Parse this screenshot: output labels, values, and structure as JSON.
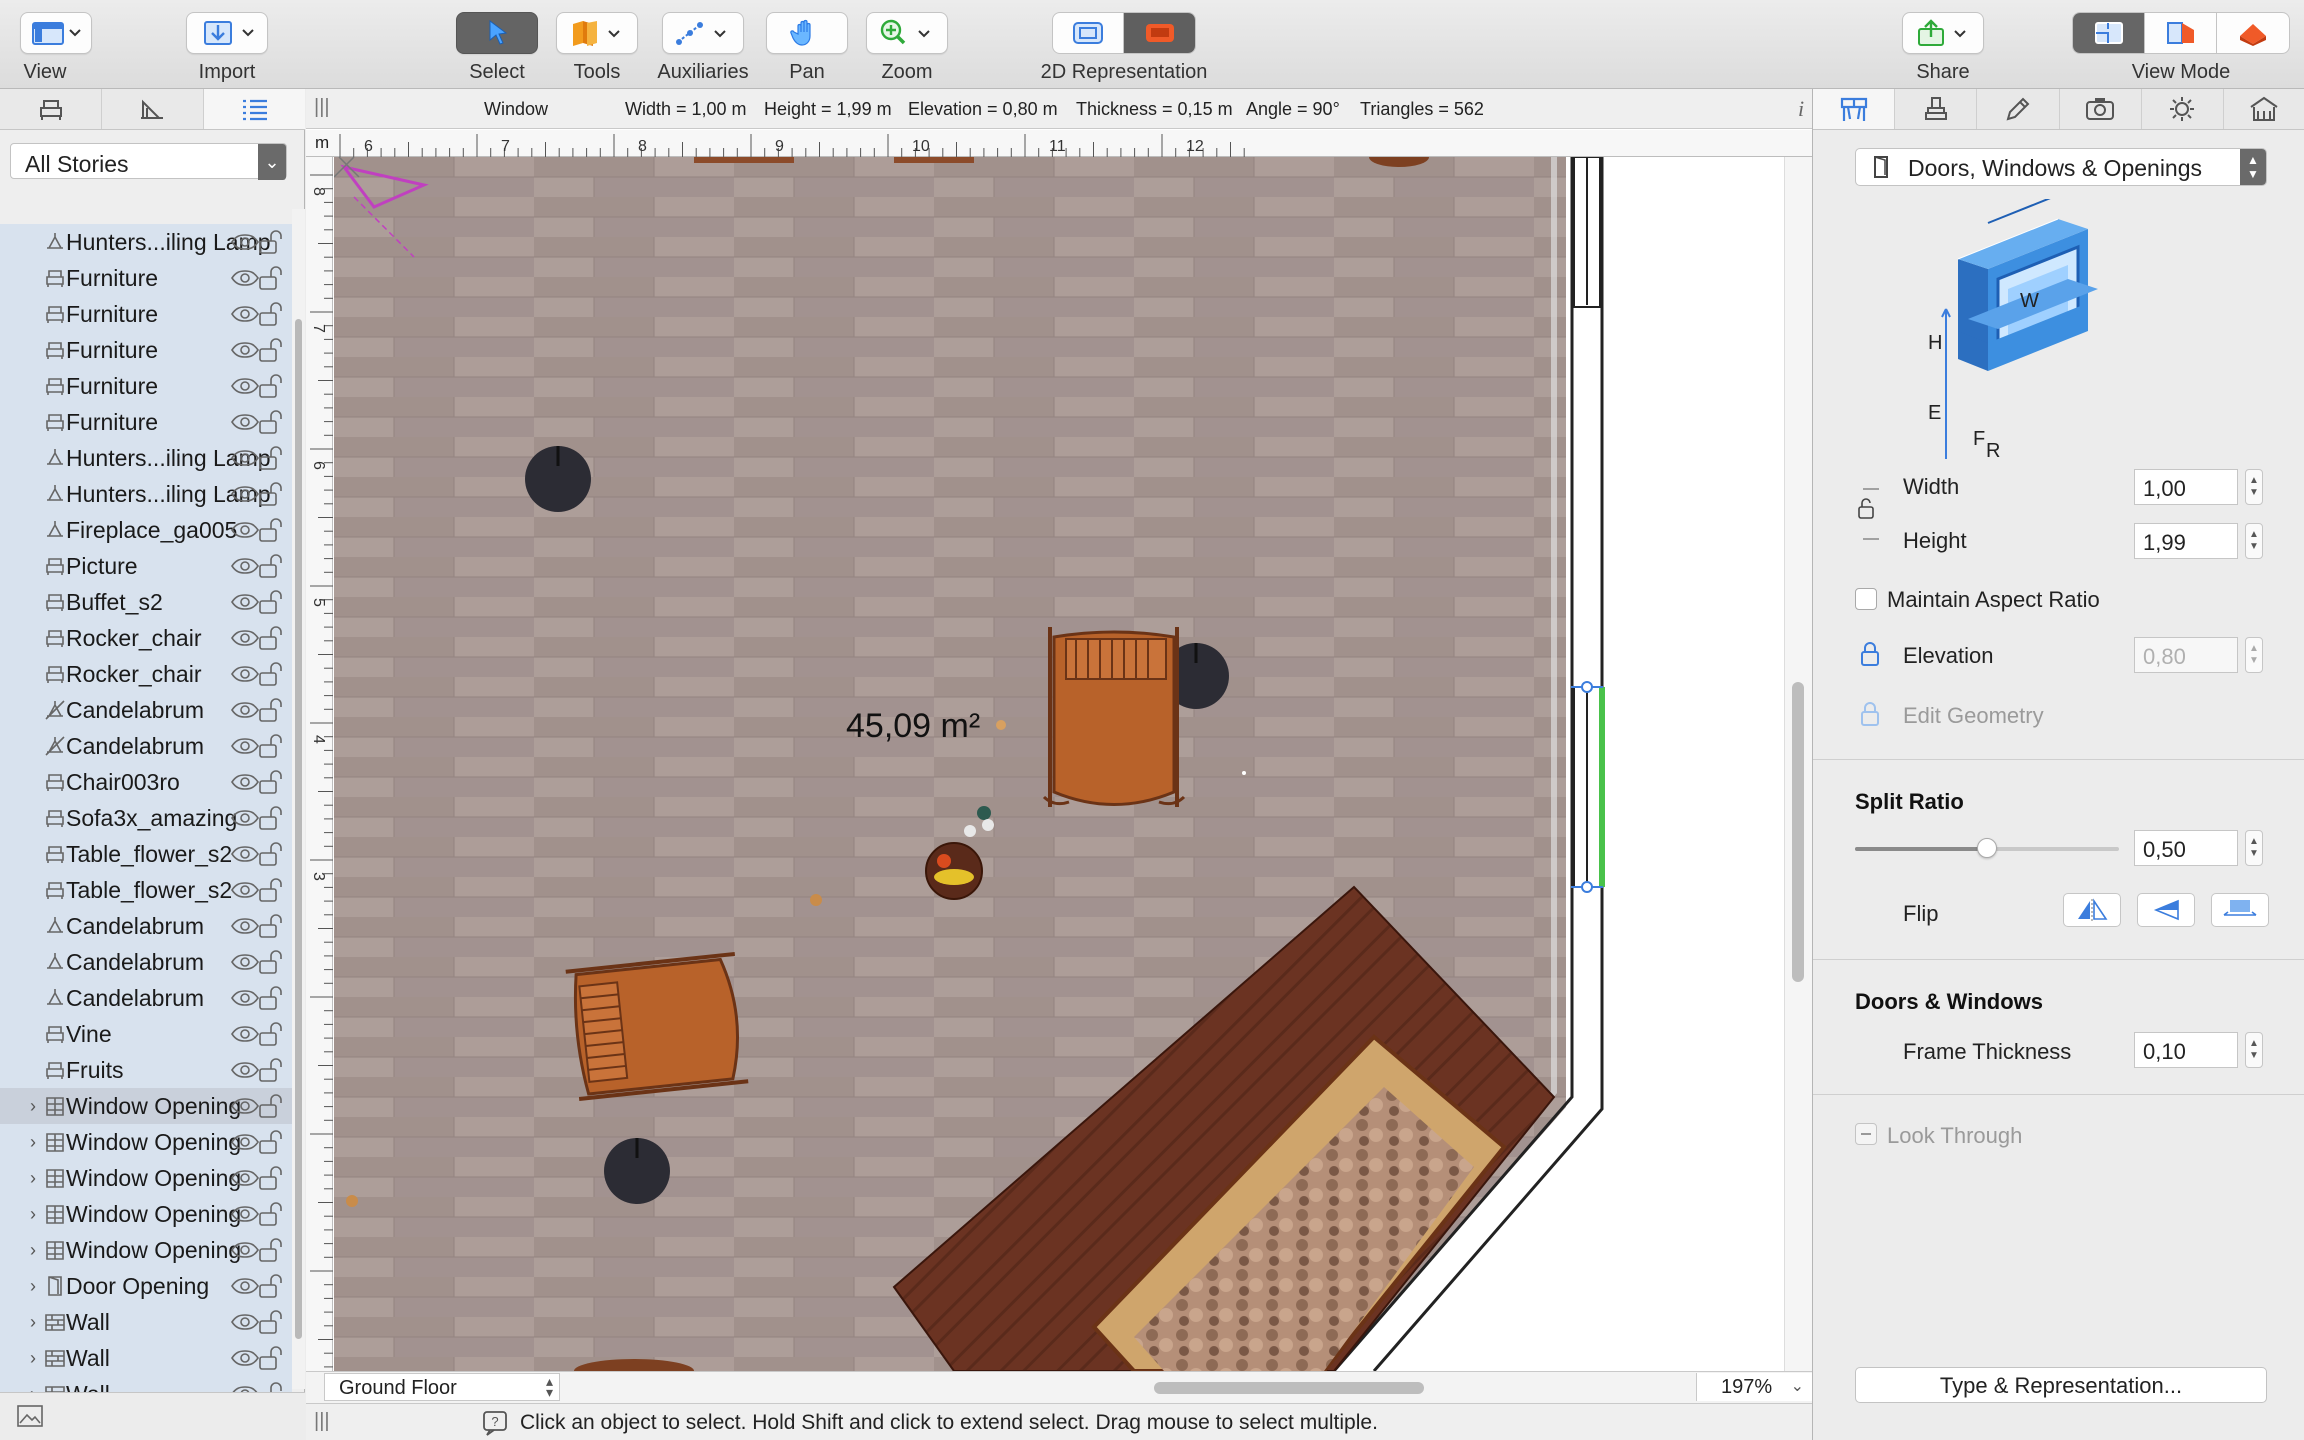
{
  "toolbar": {
    "view": "View",
    "import": "Import",
    "select": "Select",
    "tools": "Tools",
    "auxiliaries": "Auxiliaries",
    "pan": "Pan",
    "zoom": "Zoom",
    "representation": "2D Representation",
    "share": "Share",
    "view_mode": "View Mode"
  },
  "left_panel": {
    "stories": "All Stories",
    "items": [
      {
        "label": "Hunters...iling Lamp",
        "icon": "lamp-icon",
        "expandable": false
      },
      {
        "label": "Furniture",
        "icon": "furniture-icon",
        "expandable": false
      },
      {
        "label": "Furniture",
        "icon": "furniture-icon",
        "expandable": false
      },
      {
        "label": "Furniture",
        "icon": "furniture-icon",
        "expandable": false
      },
      {
        "label": "Furniture",
        "icon": "furniture-icon",
        "expandable": false
      },
      {
        "label": "Furniture",
        "icon": "furniture-icon",
        "expandable": false
      },
      {
        "label": "Hunters...iling Lamp",
        "icon": "lamp-icon",
        "expandable": false
      },
      {
        "label": "Hunters...iling Lamp",
        "icon": "lamp-icon",
        "expandable": false
      },
      {
        "label": "Fireplace_ga005",
        "icon": "lamp-icon",
        "expandable": false
      },
      {
        "label": "Picture",
        "icon": "furniture-icon",
        "expandable": false
      },
      {
        "label": "Buffet_s2",
        "icon": "furniture-icon",
        "expandable": false
      },
      {
        "label": "Rocker_chair",
        "icon": "furniture-icon",
        "expandable": false
      },
      {
        "label": "Rocker_chair",
        "icon": "furniture-icon",
        "expandable": false
      },
      {
        "label": "Candelabrum",
        "icon": "light-off-icon",
        "expandable": false
      },
      {
        "label": "Candelabrum",
        "icon": "light-off-icon",
        "expandable": false
      },
      {
        "label": "Chair003ro",
        "icon": "furniture-icon",
        "expandable": false
      },
      {
        "label": "Sofa3x_amazing",
        "icon": "furniture-icon",
        "expandable": false
      },
      {
        "label": "Table_flower_s2",
        "icon": "furniture-icon",
        "expandable": false
      },
      {
        "label": "Table_flower_s2",
        "icon": "furniture-icon",
        "expandable": false
      },
      {
        "label": "Candelabrum",
        "icon": "lamp-icon",
        "expandable": false
      },
      {
        "label": "Candelabrum",
        "icon": "lamp-icon",
        "expandable": false
      },
      {
        "label": "Candelabrum",
        "icon": "lamp-icon",
        "expandable": false
      },
      {
        "label": "Vine",
        "icon": "furniture-icon",
        "expandable": false
      },
      {
        "label": "Fruits",
        "icon": "furniture-icon",
        "expandable": false
      },
      {
        "label": "Window Opening",
        "icon": "window-icon",
        "expandable": true,
        "selected": true
      },
      {
        "label": "Window Opening",
        "icon": "window-icon",
        "expandable": true
      },
      {
        "label": "Window Opening",
        "icon": "window-icon",
        "expandable": true
      },
      {
        "label": "Window Opening",
        "icon": "window-icon",
        "expandable": true
      },
      {
        "label": "Window Opening",
        "icon": "window-icon",
        "expandable": true
      },
      {
        "label": "Door Opening",
        "icon": "door-icon",
        "expandable": true
      },
      {
        "label": "Wall",
        "icon": "wall-icon",
        "expandable": true
      },
      {
        "label": "Wall",
        "icon": "wall-icon",
        "expandable": true
      },
      {
        "label": "Wall",
        "icon": "wall-icon",
        "expandable": true
      }
    ]
  },
  "info_bar": {
    "object": "Window",
    "width": "Width = 1,00 m",
    "height": "Height = 1,99 m",
    "elevation": "Elevation = 0,80 m",
    "thickness": "Thickness = 0,15 m",
    "angle": "Angle = 90°",
    "triangles": "Triangles = 562"
  },
  "ruler": {
    "unit": "m",
    "h_ticks": [
      "6",
      "7",
      "8",
      "9",
      "10",
      "11",
      "12"
    ],
    "v_ticks": [
      "8",
      "7",
      "6",
      "5",
      "4",
      "3"
    ]
  },
  "plan": {
    "area_label": "45,09 m²",
    "floor": "Ground Floor",
    "zoom": "197%"
  },
  "status": {
    "message": "Click an object to select. Hold Shift and click to extend select. Drag mouse to select multiple."
  },
  "inspector": {
    "type": "Doors, Windows & Openings",
    "diagram_labels": {
      "w": "W",
      "h": "H",
      "f": "F",
      "e": "E",
      "r": "R"
    },
    "width_label": "Width",
    "width_value": "1,00",
    "height_label": "Height",
    "height_value": "1,99",
    "maintain_aspect": "Maintain Aspect Ratio",
    "elevation_label": "Elevation",
    "elevation_value": "0,80",
    "edit_geometry": "Edit Geometry",
    "split_ratio_header": "Split Ratio",
    "split_ratio_value": "0,50",
    "split_ratio": 0.5,
    "flip_label": "Flip",
    "doors_windows_header": "Doors & Windows",
    "frame_thickness_label": "Frame Thickness",
    "frame_thickness_value": "0,10",
    "look_through": "Look Through",
    "type_rep_button": "Type & Representation..."
  },
  "colors": {
    "accent_blue": "#3b7ddd",
    "tree_bg": "#d8e2ee",
    "floor": "#a89a95",
    "window_green": "#49c24a"
  }
}
